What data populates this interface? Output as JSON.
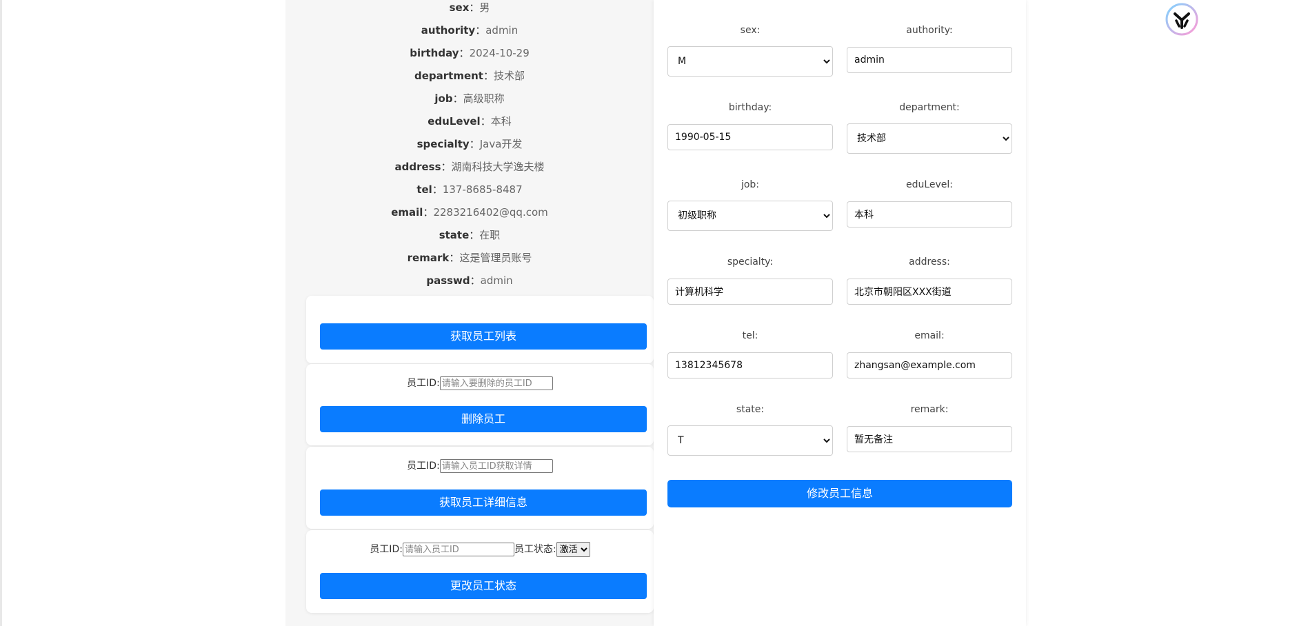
{
  "employee_info": [
    {
      "key": "sex",
      "value": "男"
    },
    {
      "key": "authority",
      "value": "admin"
    },
    {
      "key": "birthday",
      "value": "2024-10-29"
    },
    {
      "key": "department",
      "value": "技术部"
    },
    {
      "key": "job",
      "value": "高级职称"
    },
    {
      "key": "eduLevel",
      "value": "本科"
    },
    {
      "key": "specialty",
      "value": "Java开发"
    },
    {
      "key": "address",
      "value": "湖南科技大学逸夫楼"
    },
    {
      "key": "tel",
      "value": "137-8685-8487"
    },
    {
      "key": "email",
      "value": "2283216402@qq.com"
    },
    {
      "key": "state",
      "value": "在职"
    },
    {
      "key": "remark",
      "value": "这是管理员账号"
    },
    {
      "key": "passwd",
      "value": "admin"
    }
  ],
  "info_separator": "：",
  "list_card": {
    "button": "获取员工列表"
  },
  "delete_card": {
    "label": "员工ID:",
    "placeholder": "请输入要删除的员工ID",
    "button": "删除员工"
  },
  "detail_card": {
    "label": "员工ID:",
    "placeholder": "请输入员工ID获取详情",
    "button": "获取员工详细信息"
  },
  "status_card": {
    "id_label": "员工ID:",
    "id_placeholder": "请输入员工ID",
    "status_label": "员工状态:",
    "status_value": "激活",
    "button": "更改员工状态"
  },
  "edit_form": {
    "sex": {
      "label": "sex:",
      "value": "M"
    },
    "authority": {
      "label": "authority:",
      "value": "admin"
    },
    "birthday": {
      "label": "birthday:",
      "value": "1990-05-15"
    },
    "department": {
      "label": "department:",
      "value": "技术部"
    },
    "job": {
      "label": "job:",
      "value": "初级职称"
    },
    "eduLevel": {
      "label": "eduLevel:",
      "value": "本科"
    },
    "specialty": {
      "label": "specialty:",
      "value": "计算机科学"
    },
    "address": {
      "label": "address:",
      "value": "北京市朝阳区XXX街道"
    },
    "tel": {
      "label": "tel:",
      "value": "13812345678"
    },
    "email": {
      "label": "email:",
      "value": "zhangsan@example.com"
    },
    "state": {
      "label": "state:",
      "value": "T"
    },
    "remark": {
      "label": "remark:",
      "value": "暂无备注"
    },
    "submit": "修改员工信息"
  },
  "logo_icon": "app-logo-icon",
  "colors": {
    "primary": "#0a7cff",
    "panel_bg": "#f6f6f6"
  }
}
